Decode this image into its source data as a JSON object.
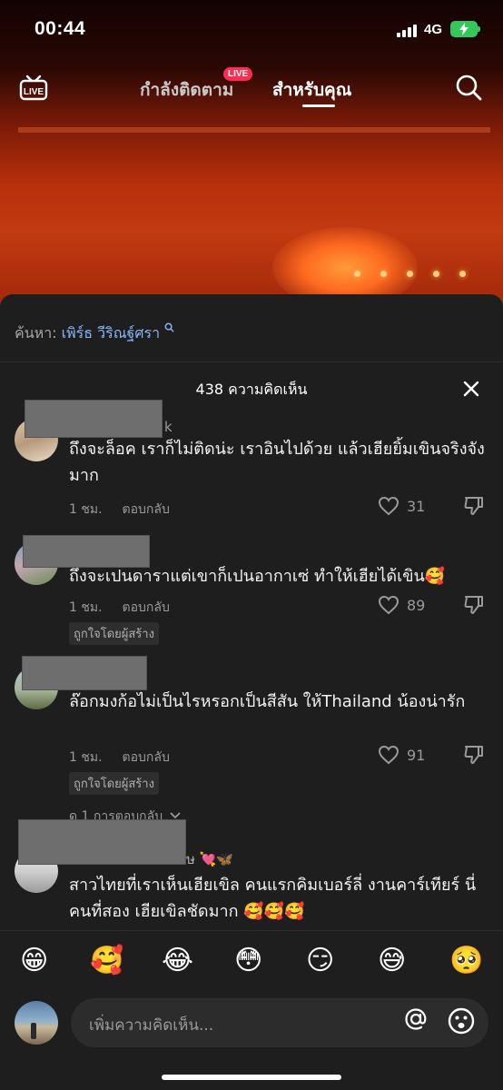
{
  "status_bar": {
    "time": "00:44",
    "network": "4G"
  },
  "nav": {
    "tabs": [
      {
        "label": "กำลังติดตาม"
      },
      {
        "label": "สำหรับคุณ"
      }
    ],
    "live_badge": "LIVE",
    "active_tab": "สำหรับคุณ"
  },
  "search_suggestion": {
    "label": "ค้นหา:",
    "term": "เพิร์ธ วีริณฐ์ศรา"
  },
  "comments_header": {
    "count_text": "438 ความคิดเห็น"
  },
  "comments": [
    {
      "name_suffix": "k",
      "text": "ถึงจะล็อค เราก็ไม่ติดน่ะ เราอินไปด้วย แล้วเฮียยิ้มเขินจริงจังมาก",
      "time": "1 ชม.",
      "reply_label": "ตอบกลับ",
      "likes": "31"
    },
    {
      "text": "ถึงจะเปนดาราแต่เขาก็เปนอากาเซ่ ทำให้เฮียได้เขิน🥰",
      "time": "1 ชม.",
      "reply_label": "ตอบกลับ",
      "likes": "89",
      "creator_badge": "ถูกใจโดยผู้สร้าง"
    },
    {
      "text": "ล๊อกมงก้อไม่เป็นไรหรอกเป็นสีสัน ให้Thailand น้องน่ารัก",
      "time": "1 ชม.",
      "reply_label": "ตอบกลับ",
      "likes": "91",
      "creator_badge": "ถูกใจโดยผู้สร้าง",
      "view_replies": "ดู 1 การตอบกลับ"
    },
    {
      "name_suffix": "ษ 💘🦋",
      "text": "สาวไทยที่เราเห็นเฮียเขิล คนแรกคิมเบอร์ลี่ งานคาร์เทียร์ นี่คนที่สอง เฮียเขิลชัดมาก 🥰🥰🥰"
    }
  ],
  "quick_emojis": [
    "😁",
    "🥰",
    "😂",
    "😳",
    "😏",
    "😅",
    "🥺"
  ],
  "composer": {
    "placeholder": "เพิ่มความคิดเห็น..."
  },
  "colors": {
    "accent_live": "#fe2c55",
    "sheet_bg": "#1e1e1e",
    "link": "#8ab4f8",
    "battery": "#34c759"
  }
}
